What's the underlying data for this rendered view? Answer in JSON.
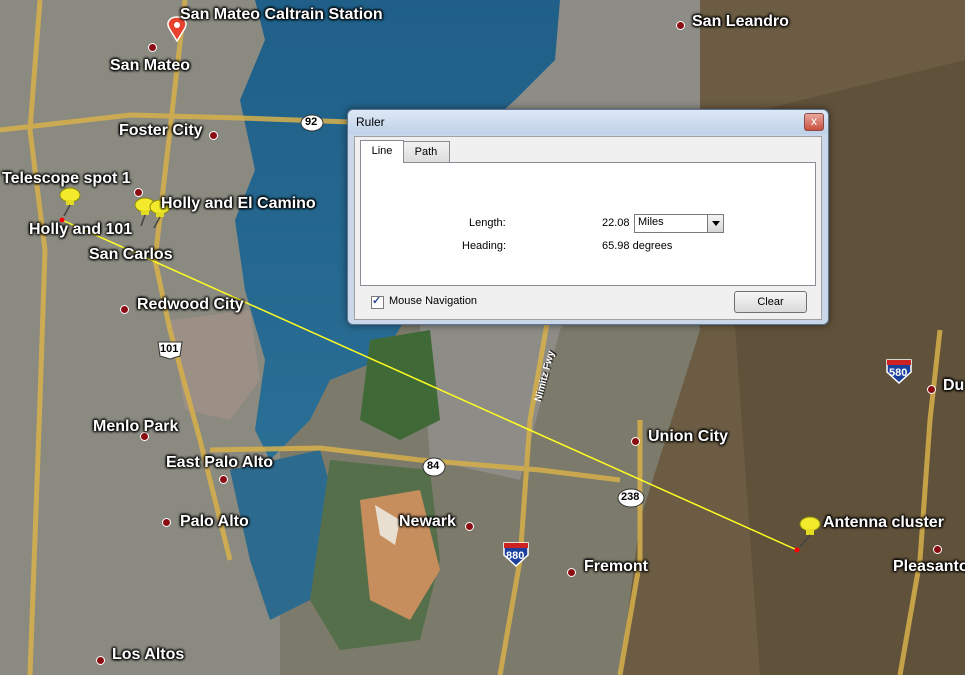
{
  "map": {
    "places": [
      {
        "id": "san-mateo-caltrain",
        "label": "San Mateo Caltrain Station"
      },
      {
        "id": "san-mateo",
        "label": "San Mateo"
      },
      {
        "id": "san-leandro",
        "label": "San Leandro"
      },
      {
        "id": "foster-city",
        "label": "Foster City"
      },
      {
        "id": "telescope-spot-1",
        "label": "Telescope spot 1"
      },
      {
        "id": "holly-el-camino",
        "label": "Holly and El Camino"
      },
      {
        "id": "holly-101",
        "label": "Holly and 101"
      },
      {
        "id": "san-carlos",
        "label": "San Carlos"
      },
      {
        "id": "redwood-city",
        "label": "Redwood City"
      },
      {
        "id": "menlo-park",
        "label": "Menlo Park"
      },
      {
        "id": "east-palo-alto",
        "label": "East Palo Alto"
      },
      {
        "id": "palo-alto",
        "label": "Palo Alto"
      },
      {
        "id": "los-altos",
        "label": "Los Altos"
      },
      {
        "id": "newark",
        "label": "Newark"
      },
      {
        "id": "fremont",
        "label": "Fremont"
      },
      {
        "id": "union-city",
        "label": "Union City"
      },
      {
        "id": "antenna-cluster",
        "label": "Antenna cluster"
      },
      {
        "id": "pleasanton",
        "label": "Pleasanto"
      },
      {
        "id": "dublin",
        "label": "Du"
      }
    ],
    "roads": {
      "r92": "92",
      "r101": "101",
      "r84": "84",
      "r238": "238",
      "r880": "880",
      "r580": "580",
      "nimitz": "Nimitz Fwy"
    }
  },
  "ruler": {
    "title": "Ruler",
    "close_glyph": "x",
    "tabs": [
      {
        "label": "Line",
        "active": true
      },
      {
        "label": "Path",
        "active": false
      }
    ],
    "length_label": "Length:",
    "length_value": "22.08",
    "unit": "Miles",
    "heading_label": "Heading:",
    "heading_value": "65.98 degrees",
    "mouse_navigation_label": "Mouse Navigation",
    "mouse_navigation_checked": true,
    "clear_label": "Clear"
  }
}
